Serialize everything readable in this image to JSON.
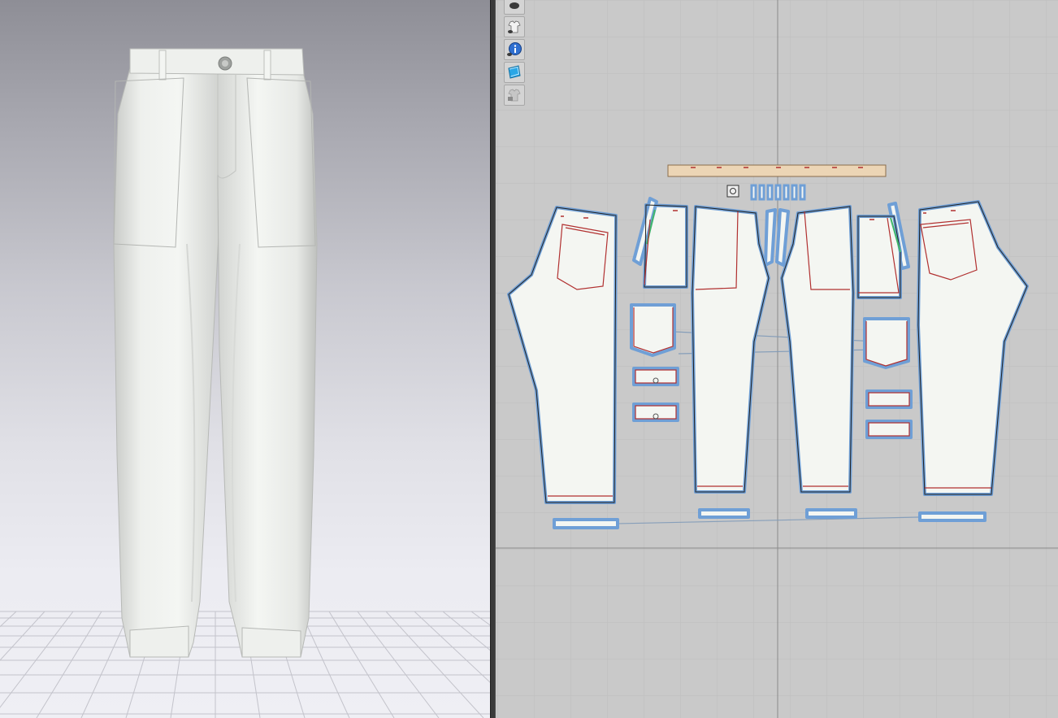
{
  "app": {
    "views": [
      "3d-avatar-window",
      "2d-pattern-window"
    ]
  },
  "viewport3d": {
    "background_top": "#8e8e96",
    "background_bottom": "#efeff4",
    "garment_color": "#f1f3f0",
    "garment": "pants"
  },
  "viewport2d": {
    "background": "#c9c9c9",
    "grid_color": "#bdbdbd",
    "axis_color": "#8a8a8a",
    "piece_fill": "#f4f6f2",
    "piece_outline": "#6f9fd6",
    "waistband_fill": "#ecd5b5",
    "seam_color": "#b13030",
    "toolbar": {
      "buttons": [
        {
          "icon": "show-avatar-icon",
          "active": false
        },
        {
          "icon": "show-garment-icon",
          "active": false
        },
        {
          "icon": "info-icon",
          "active": true
        },
        {
          "icon": "texture-view-icon",
          "active": true
        },
        {
          "icon": "lock-garment-icon",
          "active": false
        }
      ]
    }
  }
}
